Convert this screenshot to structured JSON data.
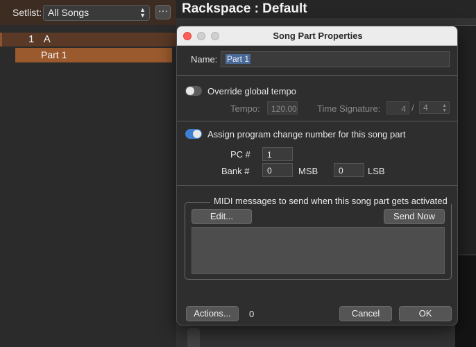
{
  "sidebar": {
    "setlist_label": "Setlist:",
    "setlist_value": "All Songs",
    "more_label": "···",
    "song": {
      "number": "1",
      "name": "A"
    },
    "part": {
      "name": "Part 1"
    }
  },
  "header": {
    "title": "Rackspace : Default"
  },
  "dialog": {
    "title": "Song Part Properties",
    "name_label": "Name:",
    "name_value": "Part 1",
    "override_tempo_label": "Override global tempo",
    "override_tempo_enabled": false,
    "tempo_label": "Tempo:",
    "tempo_value": "120.00",
    "time_signature_label": "Time Signature:",
    "time_sig_numerator": "4",
    "time_sig_separator": "/",
    "time_sig_denominator": "4",
    "program_change_label": "Assign program change number for this song part",
    "program_change_enabled": true,
    "pc_label": "PC #",
    "pc_value": "1",
    "bank_label": "Bank #",
    "msb_value": "0",
    "msb_label": "MSB",
    "lsb_value": "0",
    "lsb_label": "LSB",
    "midi_group_title": "MIDI messages to send when this song part gets activated",
    "edit_label": "Edit...",
    "send_now_label": "Send Now",
    "actions_label": "Actions...",
    "actions_count": "0",
    "cancel_label": "Cancel",
    "ok_label": "OK"
  },
  "colors": {
    "accent_orange": "#9a5a2e",
    "toggle_on": "#3f7fd0",
    "close_red": "#fe5f57"
  }
}
